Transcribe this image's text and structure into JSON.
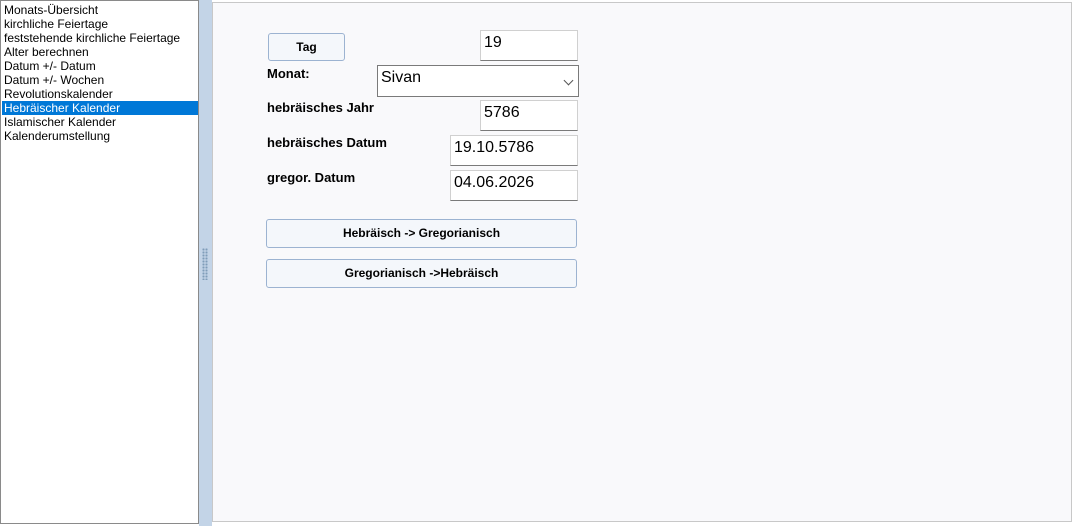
{
  "sidebar": {
    "items": [
      {
        "label": "Monats-Übersicht"
      },
      {
        "label": "kirchliche Feiertage"
      },
      {
        "label": "feststehende kirchliche Feiertage"
      },
      {
        "label": "Alter berechnen"
      },
      {
        "label": "Datum +/- Datum"
      },
      {
        "label": "Datum +/- Wochen"
      },
      {
        "label": "Revolutionskalender"
      },
      {
        "label": "Hebräischer Kalender"
      },
      {
        "label": "Islamischer Kalender"
      },
      {
        "label": "Kalenderumstellung"
      }
    ],
    "selected": "Hebräischer Kalender"
  },
  "form": {
    "tag_button": "Tag",
    "tag_value": "19",
    "monat_label": "Monat:",
    "monat_value": "Sivan",
    "jahr_label": "hebräisches Jahr",
    "jahr_value": "5786",
    "hdatum_label": "hebräisches Datum",
    "hdatum_value": "19.10.5786",
    "gdatum_label": "gregor. Datum",
    "gdatum_value": "04.06.2026",
    "btn_heb_to_greg": "Hebräisch -> Gregorianisch",
    "btn_greg_to_heb": "Gregorianisch ->Hebräisch"
  },
  "colors": {
    "selection": "#0078d7",
    "splitter": "#c3d4e7",
    "button_border": "#9cb3d1"
  }
}
